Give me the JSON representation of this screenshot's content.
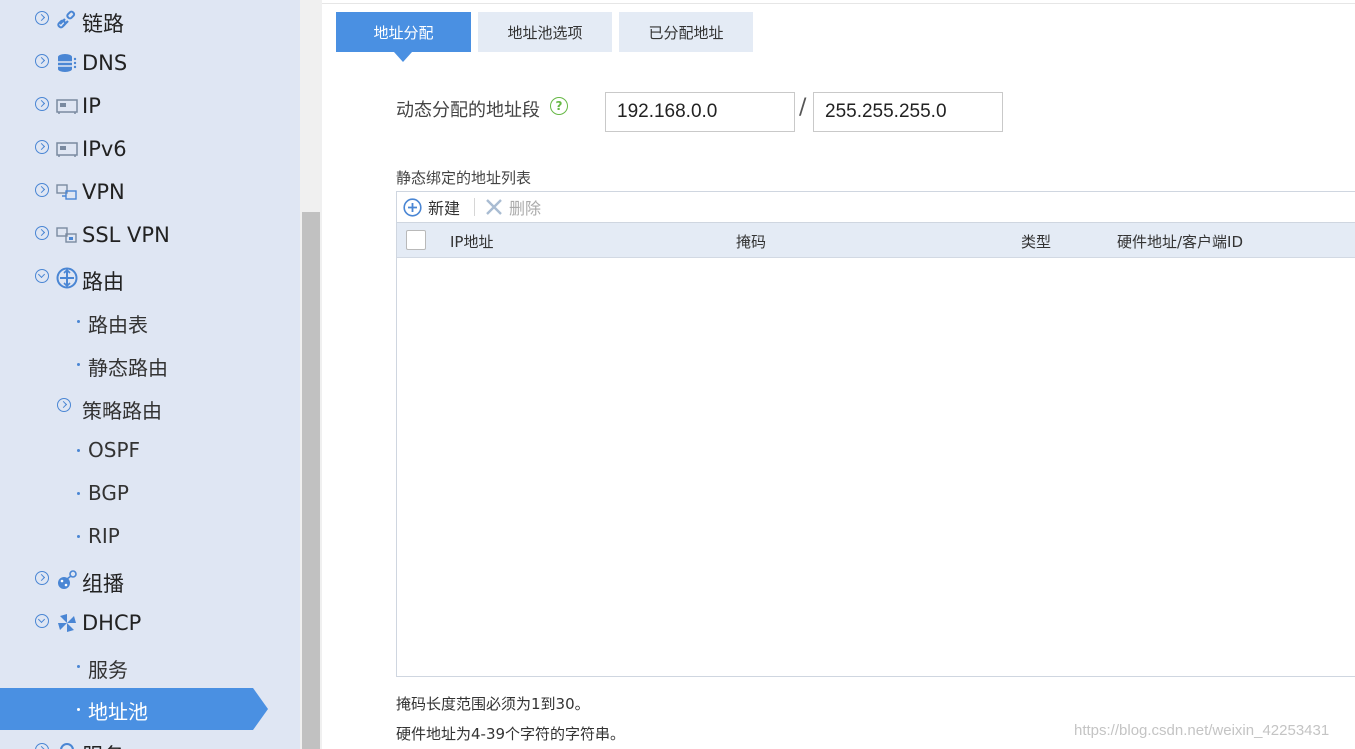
{
  "sidebar": {
    "items": [
      {
        "label": "链路"
      },
      {
        "label": "DNS"
      },
      {
        "label": "IP"
      },
      {
        "label": "IPv6"
      },
      {
        "label": "VPN"
      },
      {
        "label": "SSL VPN"
      },
      {
        "label": "路由"
      },
      {
        "label": "路由表"
      },
      {
        "label": "静态路由"
      },
      {
        "label": "策略路由"
      },
      {
        "label": "OSPF"
      },
      {
        "label": "BGP"
      },
      {
        "label": "RIP"
      },
      {
        "label": "组播"
      },
      {
        "label": "DHCP"
      },
      {
        "label": "服务"
      },
      {
        "label": "地址池"
      },
      {
        "label": "服务"
      }
    ],
    "active_item": "地址池"
  },
  "tabs": [
    {
      "label": "地址分配",
      "active": true
    },
    {
      "label": "地址池选项",
      "active": false
    },
    {
      "label": "已分配地址",
      "active": false
    }
  ],
  "form": {
    "dynamic_range_label": "动态分配的地址段",
    "help_glyph": "?",
    "network_value": "192.168.0.0",
    "separator": "/",
    "mask_value": "255.255.255.0"
  },
  "static_list": {
    "title": "静态绑定的地址列表",
    "new_label": "新建",
    "delete_label": "删除",
    "columns": [
      "IP地址",
      "掩码",
      "类型",
      "硬件地址/客户端ID"
    ],
    "rows": []
  },
  "notes": [
    "掩码长度范围必须为1到30。",
    "硬件地址为4-39个字符的字符串。"
  ],
  "watermark": "https://blog.csdn.net/weixin_42253431",
  "colors": {
    "accent": "#4a90e2",
    "sidebar_bg": "#dfe6f3",
    "tab_inactive": "#e4ebf5",
    "help_green": "#66b845"
  }
}
